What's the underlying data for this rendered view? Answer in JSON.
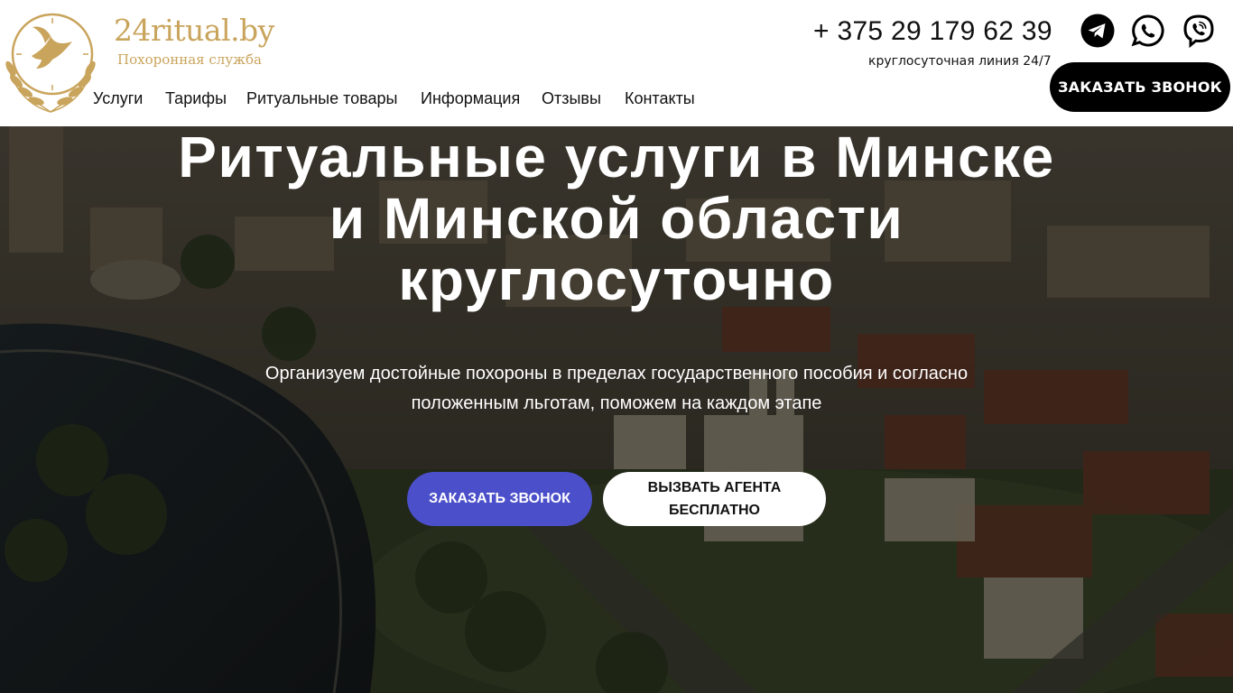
{
  "header": {
    "brand_name": "24ritual.by",
    "brand_subtitle": "Похоронная служба",
    "logo_icon": "dove-laurel-clock-emblem",
    "nav": [
      {
        "label": "Услуги"
      },
      {
        "label": "Тарифы"
      },
      {
        "label": "Ритуальные товары"
      },
      {
        "label": "Информация"
      },
      {
        "label": "Отзывы"
      },
      {
        "label": "Контакты"
      }
    ],
    "phone": "+ 375 29 179 62 39",
    "phone_note": "круглосуточная линия 24/7",
    "social_icons": [
      "telegram-icon",
      "whatsapp-icon",
      "viber-icon"
    ],
    "cta_label": "ЗАКАЗАТЬ ЗВОНОК"
  },
  "hero": {
    "title_lines": [
      "Ритуальные услуги в Минске",
      "и Минской области",
      "круглосуточно"
    ],
    "lead": "Организуем достойные похороны в пределах государственного пособия и согласно положенным льготам, поможем на каждом этапе",
    "primary_button": "ЗАКАЗАТЬ ЗВОНОК",
    "secondary_button": "ВЫЗВАТЬ АГЕНТА БЕСПЛАТНО"
  },
  "colors": {
    "brand_gold": "#c9a45c",
    "primary_button": "#4b4fc9",
    "header_bg": "#ffffff",
    "cta_dark": "#000000"
  }
}
